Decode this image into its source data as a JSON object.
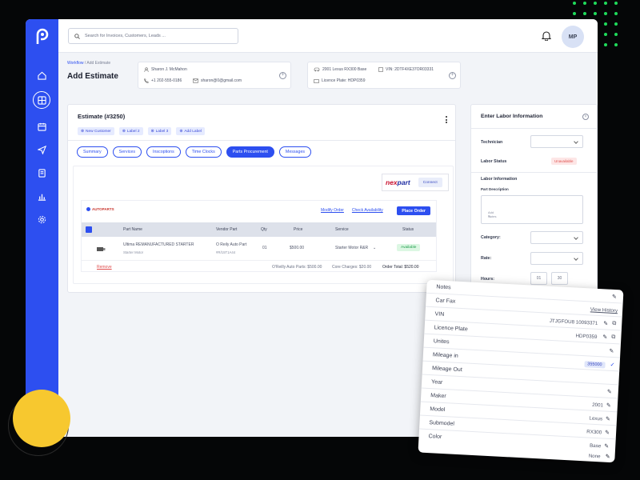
{
  "search": {
    "placeholder": "Search for Invoices, Customers, Leads ..."
  },
  "user": {
    "initials": "MP"
  },
  "breadcrumb": {
    "parent": "Workflow",
    "sep": "/",
    "current": "Add Estimate"
  },
  "page_title": "Add Estimate",
  "customer": {
    "name": "Sharon J. McMahon",
    "phone": "+1 202-555-0186",
    "email": "sharon@0@gmail.com"
  },
  "vehicle": {
    "name": "2001 Lexus RX300 Base",
    "vin": "VIN: 2DTF4XE37OR03331",
    "plate": "Licence Plate: HDP0359"
  },
  "estimate": {
    "title": "Estimate (#3250)",
    "labels": [
      "New Customer",
      "Label 2",
      "Label 3",
      "Add Label"
    ],
    "tabs": [
      "Summary",
      "Services",
      "Inscoptions",
      "Time Clocks",
      "Parts Procurement",
      "Messages"
    ]
  },
  "nexpart": {
    "brand_a": "nex",
    "brand_b": "part",
    "connect": "Connect"
  },
  "vendor": {
    "logo": "AUTOPARTS",
    "modify": "Modify Order",
    "check": "Check Availability",
    "place": "Place Order",
    "columns": [
      "Part Name",
      "Vendor Part",
      "Qty",
      "Price",
      "Service",
      "Status"
    ],
    "row": {
      "part": "Ultima REMANUFACTURED STARTER",
      "part_sub": "Starter Motor",
      "vendor": "O Reily Auto Part",
      "vendor_sub": "#R/15T1A44",
      "qty": "01",
      "price": "$500.00",
      "service": "Starter Motor R&R",
      "status": "Available"
    },
    "remove": "Remove",
    "footer": {
      "a": "O'Reilly Auto Parts: $500.00",
      "b": "Core Charges: $20.00",
      "c": "Order Total: $520.00"
    }
  },
  "labor": {
    "title": "Enter Labor Information",
    "technician": "Technician",
    "status": "Labor Status",
    "unavailable": "Unavailable",
    "section": "Labor Information",
    "part_desc": "Part Description",
    "add_notes": "Add Notes",
    "category": "Category:",
    "rate": "Rate:",
    "hours": "Hours:",
    "h1": "01",
    "h2": "30"
  },
  "notes_card": [
    {
      "k": "Notes",
      "v": ""
    },
    {
      "k": "Car Fax",
      "v": "View History"
    },
    {
      "k": "VIN",
      "v": "JTJGFOU8 10093371"
    },
    {
      "k": "Licence Plate",
      "v": "HDP0359"
    },
    {
      "k": "Unites",
      "v": ""
    },
    {
      "k": "Mileage in",
      "v": "355000"
    },
    {
      "k": "Mileage Out",
      "v": ""
    },
    {
      "k": "Year",
      "v": "2001"
    },
    {
      "k": "Maker",
      "v": "Lexus"
    },
    {
      "k": "Model",
      "v": "RX300"
    },
    {
      "k": "Submodel",
      "v": "Base"
    },
    {
      "k": "Color",
      "v": "None"
    }
  ]
}
